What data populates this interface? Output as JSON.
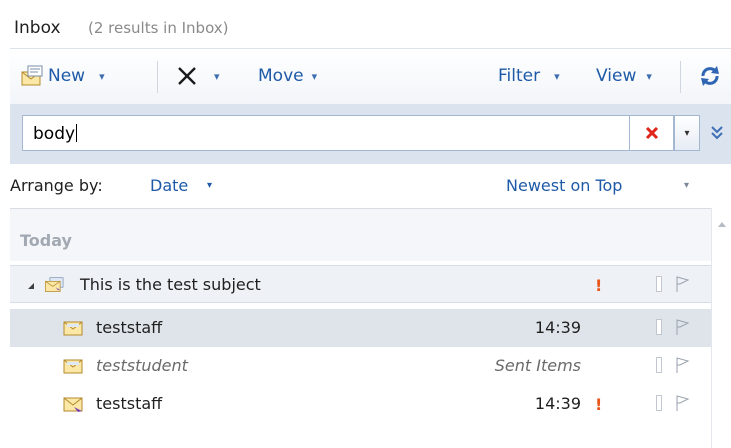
{
  "header": {
    "title": "Inbox",
    "subtitle": "(2 results in Inbox)"
  },
  "toolbar": {
    "new_label": "New",
    "delete_icon": "delete-x-icon",
    "move_label": "Move",
    "filter_label": "Filter",
    "view_label": "View",
    "refresh_icon": "refresh-icon",
    "caret": "▾"
  },
  "search": {
    "value": "body",
    "clear_icon": "clear-x-icon",
    "dropdown_icon": "chevron-down-icon",
    "expand_icon": "double-chevron-down-icon"
  },
  "arrange": {
    "label": "Arrange by:",
    "value": "Date",
    "order": "Newest on Top",
    "caret": "▾"
  },
  "list": {
    "group_label": "Today",
    "conversation": {
      "subject": "This is the test subject",
      "importance": "!"
    },
    "items": [
      {
        "sender": "teststaff",
        "time": "14:39",
        "importance": ""
      },
      {
        "sender": "teststudent",
        "time": "Sent Items",
        "importance": ""
      },
      {
        "sender": "teststaff",
        "time": "14:39",
        "importance": "!"
      }
    ]
  },
  "colors": {
    "accent": "#1e5aa8",
    "importance": "#e8561c",
    "clear": "#e0251b"
  }
}
